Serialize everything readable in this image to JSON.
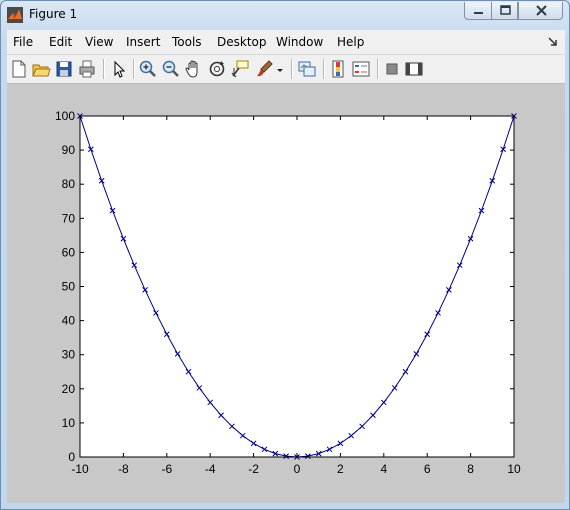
{
  "window": {
    "title": "Figure 1"
  },
  "menu": [
    "File",
    "Edit",
    "View",
    "Insert",
    "Tools",
    "Desktop",
    "Window",
    "Help"
  ],
  "toolbar": {
    "icons": [
      "new-figure-icon",
      "open-file-icon",
      "save-icon",
      "print-icon",
      "pointer-icon",
      "zoom-in-icon",
      "zoom-out-icon",
      "pan-hand-icon",
      "rotate-3d-icon",
      "data-cursor-icon",
      "brush-icon",
      "brush-dropdown-icon",
      "link-plot-icon",
      "colorbar-icon",
      "legend-icon",
      "hide-plot-tools-icon",
      "show-plot-tools-icon"
    ]
  },
  "colors": {
    "line": "#00008b",
    "axes_bg": "#ffffff",
    "figure_bg": "#c8c8c8"
  },
  "chart_data": {
    "type": "line",
    "marker": "x",
    "x": [
      -10,
      -9.5,
      -9,
      -8.5,
      -8,
      -7.5,
      -7,
      -6.5,
      -6,
      -5.5,
      -5,
      -4.5,
      -4,
      -3.5,
      -3,
      -2.5,
      -2,
      -1.5,
      -1,
      -0.5,
      0,
      0.5,
      1,
      1.5,
      2,
      2.5,
      3,
      3.5,
      4,
      4.5,
      5,
      5.5,
      6,
      6.5,
      7,
      7.5,
      8,
      8.5,
      9,
      9.5,
      10
    ],
    "y": [
      100,
      90.25,
      81,
      72.25,
      64,
      56.25,
      49,
      42.25,
      36,
      30.25,
      25,
      20.25,
      16,
      12.25,
      9,
      6.25,
      4,
      2.25,
      1,
      0.25,
      0,
      0.25,
      1,
      2.25,
      4,
      6.25,
      9,
      12.25,
      16,
      20.25,
      25,
      30.25,
      36,
      42.25,
      49,
      56.25,
      64,
      72.25,
      81,
      90.25,
      100
    ],
    "xlim": [
      -10,
      10
    ],
    "ylim": [
      0,
      100
    ],
    "xticks": [
      "-10",
      "-8",
      "-6",
      "-4",
      "-2",
      "0",
      "2",
      "4",
      "6",
      "8",
      "10"
    ],
    "yticks": [
      "0",
      "10",
      "20",
      "30",
      "40",
      "50",
      "60",
      "70",
      "80",
      "90",
      "100"
    ],
    "grid": false
  }
}
